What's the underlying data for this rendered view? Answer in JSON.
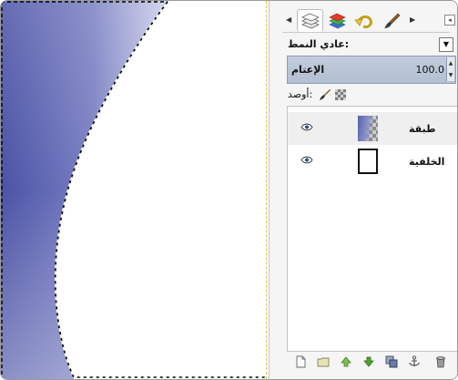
{
  "panel": {
    "tabs": [
      {
        "name": "layers-tab",
        "active": true
      },
      {
        "name": "channels-tab",
        "active": false
      },
      {
        "name": "undo-history-tab",
        "active": false
      },
      {
        "name": "brushes-tab",
        "active": false
      }
    ],
    "mode_label": "عادي النمط:",
    "opacity_label": "الإعتام",
    "opacity_value": "100.0",
    "lock_label": "أوصد:",
    "layers": [
      {
        "name": "طبقة",
        "visible": true,
        "selected": true
      },
      {
        "name": "الخلفية",
        "visible": true,
        "selected": false
      }
    ],
    "bottom_actions": [
      "new-layer-icon",
      "new-layer-group-icon",
      "raise-layer-icon",
      "lower-layer-icon",
      "duplicate-layer-icon",
      "anchor-layer-icon",
      "delete-layer-icon"
    ]
  },
  "colors": {
    "gradient_dark": "#4a52a6",
    "gradient_light": "#d8daf0",
    "opacity_bar": "#b8c3d6",
    "selection_guide": "#d8c94a"
  }
}
